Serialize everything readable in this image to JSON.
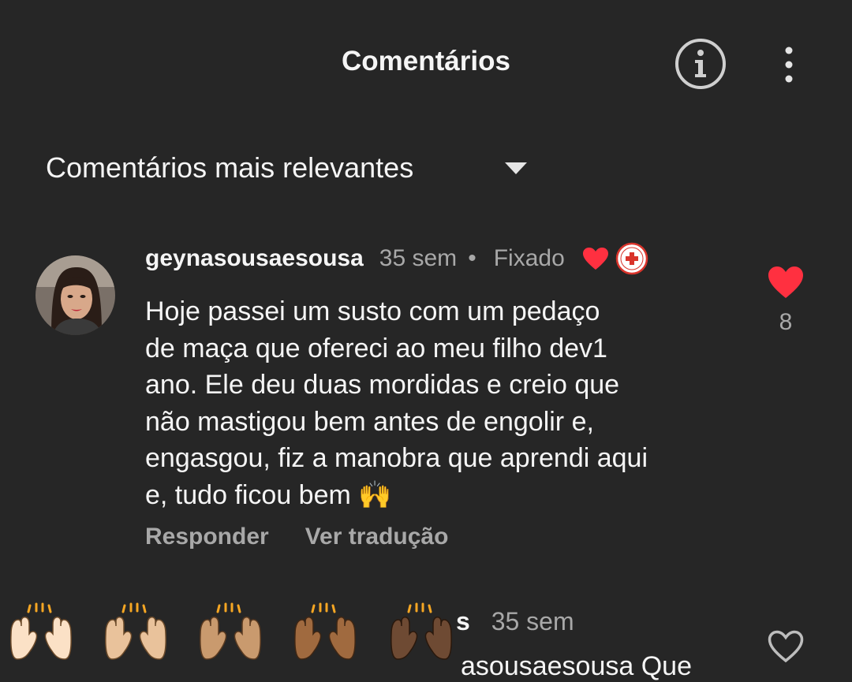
{
  "header": {
    "title": "Comentários",
    "info_icon": "info-icon",
    "more_icon": "more-vertical-icon"
  },
  "sort": {
    "label": "Comentários mais relevantes",
    "icon": "caret-down-icon"
  },
  "comment": {
    "username": "geynasousaesousa",
    "time": "35 sem",
    "separator": "•",
    "pinned_label": "Fixado",
    "creator_liked_icon": "red-heart-icon",
    "creator_badge_icon": "gigas-salvam-vidas-badge",
    "text_lines": [
      "Hoje passei um susto com um pedaço",
      "de maça que ofereci ao meu filho dev1",
      "ano. Ele deu duas mordidas e creio que",
      "não mastigou bem antes de engolir e,",
      "engasgou, fiz a manobra que aprendi aqui",
      "e, tudo ficou bem 🙌"
    ],
    "reply_label": "Responder",
    "translate_label": "Ver tradução",
    "like_count": "8",
    "liked": true,
    "liked_color": "#ff3040"
  },
  "next_comment": {
    "username_partial": "s",
    "time": "35 sem",
    "text_partial": "asousaesousa Que"
  },
  "emoji_picker": {
    "emoji": "raising-hands",
    "skin_tones": [
      "#fbe1c6",
      "#e9c29b",
      "#c99a6e",
      "#a06a3f",
      "#6e4a33"
    ]
  },
  "colors": {
    "background": "#262626",
    "text_primary": "#f5f5f5",
    "text_secondary": "#a8a8a8",
    "accent_red": "#ff3040"
  }
}
